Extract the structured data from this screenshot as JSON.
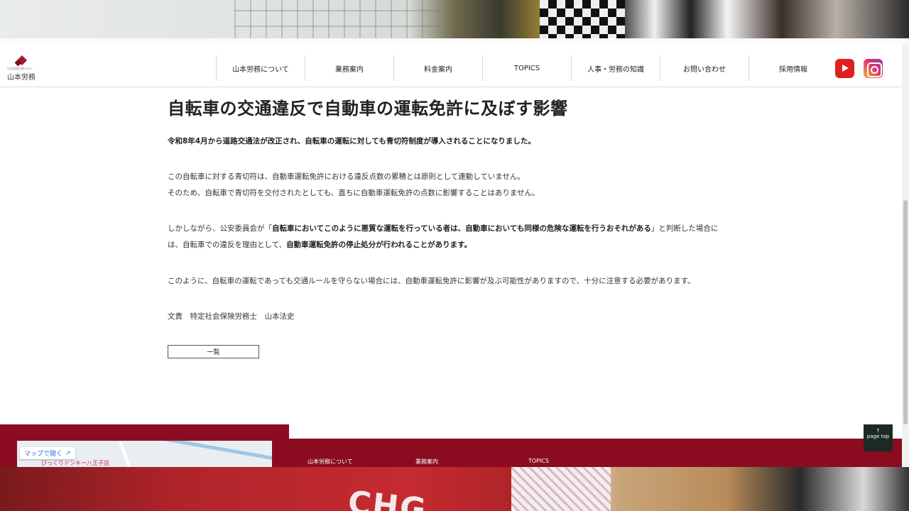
{
  "header": {
    "logo_subtitle": "社会保険労務士法人",
    "logo_name": "山本労務",
    "nav": [
      "山本労務について",
      "業務案内",
      "料金案内",
      "TOPICS",
      "人事・労務の知識",
      "お問い合わせ",
      "採用情報"
    ],
    "sns": [
      "youtube-icon",
      "instagram-icon"
    ]
  },
  "article": {
    "title": "自転車の交通違反で自動車の運転免許に及ぼす影響",
    "lead": "令和8年4月から道路交通法が改正され、自転車の運転に対しても青切符制度が導入されることになりました。",
    "p2_line1": "この自転車に対する青切符は、自動車運転免許における違反点数の累積とは原則として連動していません。",
    "p2_line2": "そのため、自転車で青切符を交付されたとしても、直ちに自動車運転免許の点数に影響することはありません。",
    "p3_a": "しかしながら、公安委員会が「",
    "p3_bold1": "自転車においてこのように悪質な運転を行っている者は、自動車においても同様の危険な運転を行うおそれがある",
    "p3_b": "」と判断した場合に",
    "p3_c": "は、自転車での違反を理由として、",
    "p3_bold2": "自動車運転免許の停止処分が行われることがあります。",
    "p4": "このように、自転車の運転であっても交通ルールを守らない場合には、自動車運転免許に影響が及ぶ可能性がありますので、十分に注意する必要があります。",
    "signature": "文責　特定社会保険労務士　山本法史",
    "list_button": "一覧"
  },
  "footer": {
    "map_button": "マップで開く",
    "map_place": "びっくりドンキー八王子店",
    "nav": [
      "山本労務について",
      "業務案内",
      "TOPICS"
    ],
    "pagetop": "page top",
    "pagetop_arrow": "↑"
  },
  "colors": {
    "brand": "#8b0c20",
    "youtube": "#e02020"
  }
}
